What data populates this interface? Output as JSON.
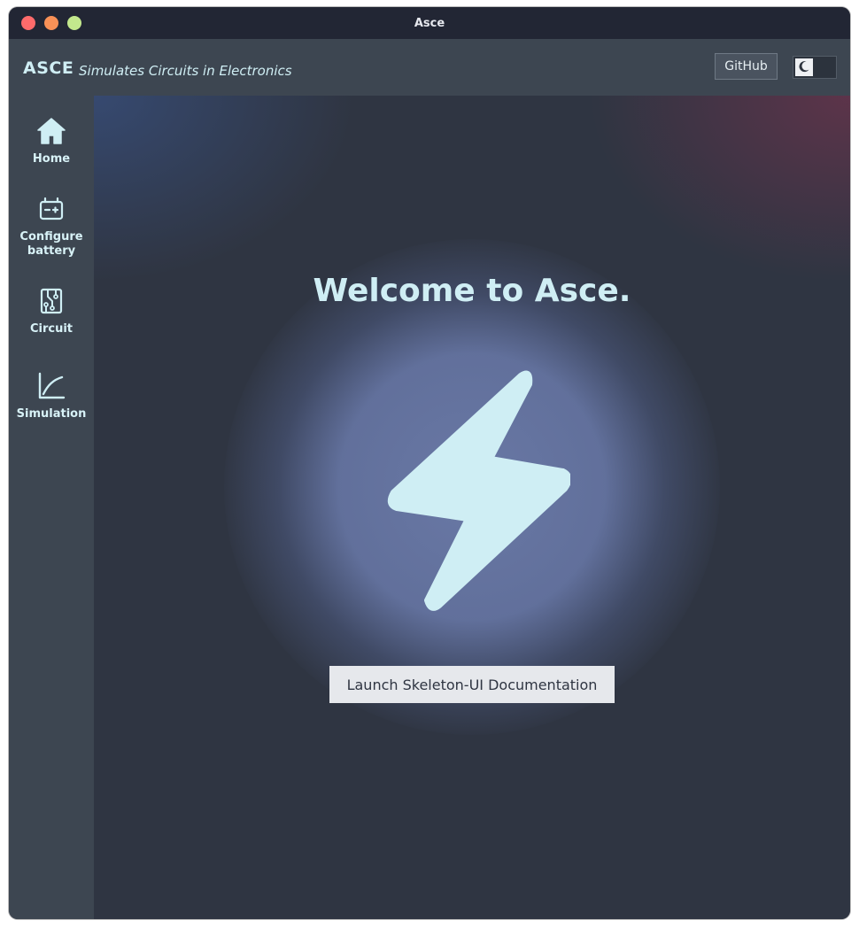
{
  "window": {
    "title": "Asce"
  },
  "header": {
    "brand": "ASCE",
    "tagline": "Simulates Circuits in Electronics",
    "github_label": "GitHub",
    "theme_toggle_icon": "moon-icon"
  },
  "sidebar": {
    "items": [
      {
        "label": "Home",
        "icon": "home-icon"
      },
      {
        "label": "Configure battery",
        "icon": "battery-icon"
      },
      {
        "label": "Circuit",
        "icon": "circuit-icon"
      },
      {
        "label": "Simulation",
        "icon": "chart-line-icon"
      }
    ]
  },
  "main": {
    "welcome": "Welcome to Asce.",
    "hero_icon": "lightning-bolt-icon",
    "doc_button_label": "Launch Skeleton-UI Documentation"
  },
  "colors": {
    "accent": "#cfeef4",
    "background": "#2f3542",
    "sidebar": "#3d4651"
  }
}
